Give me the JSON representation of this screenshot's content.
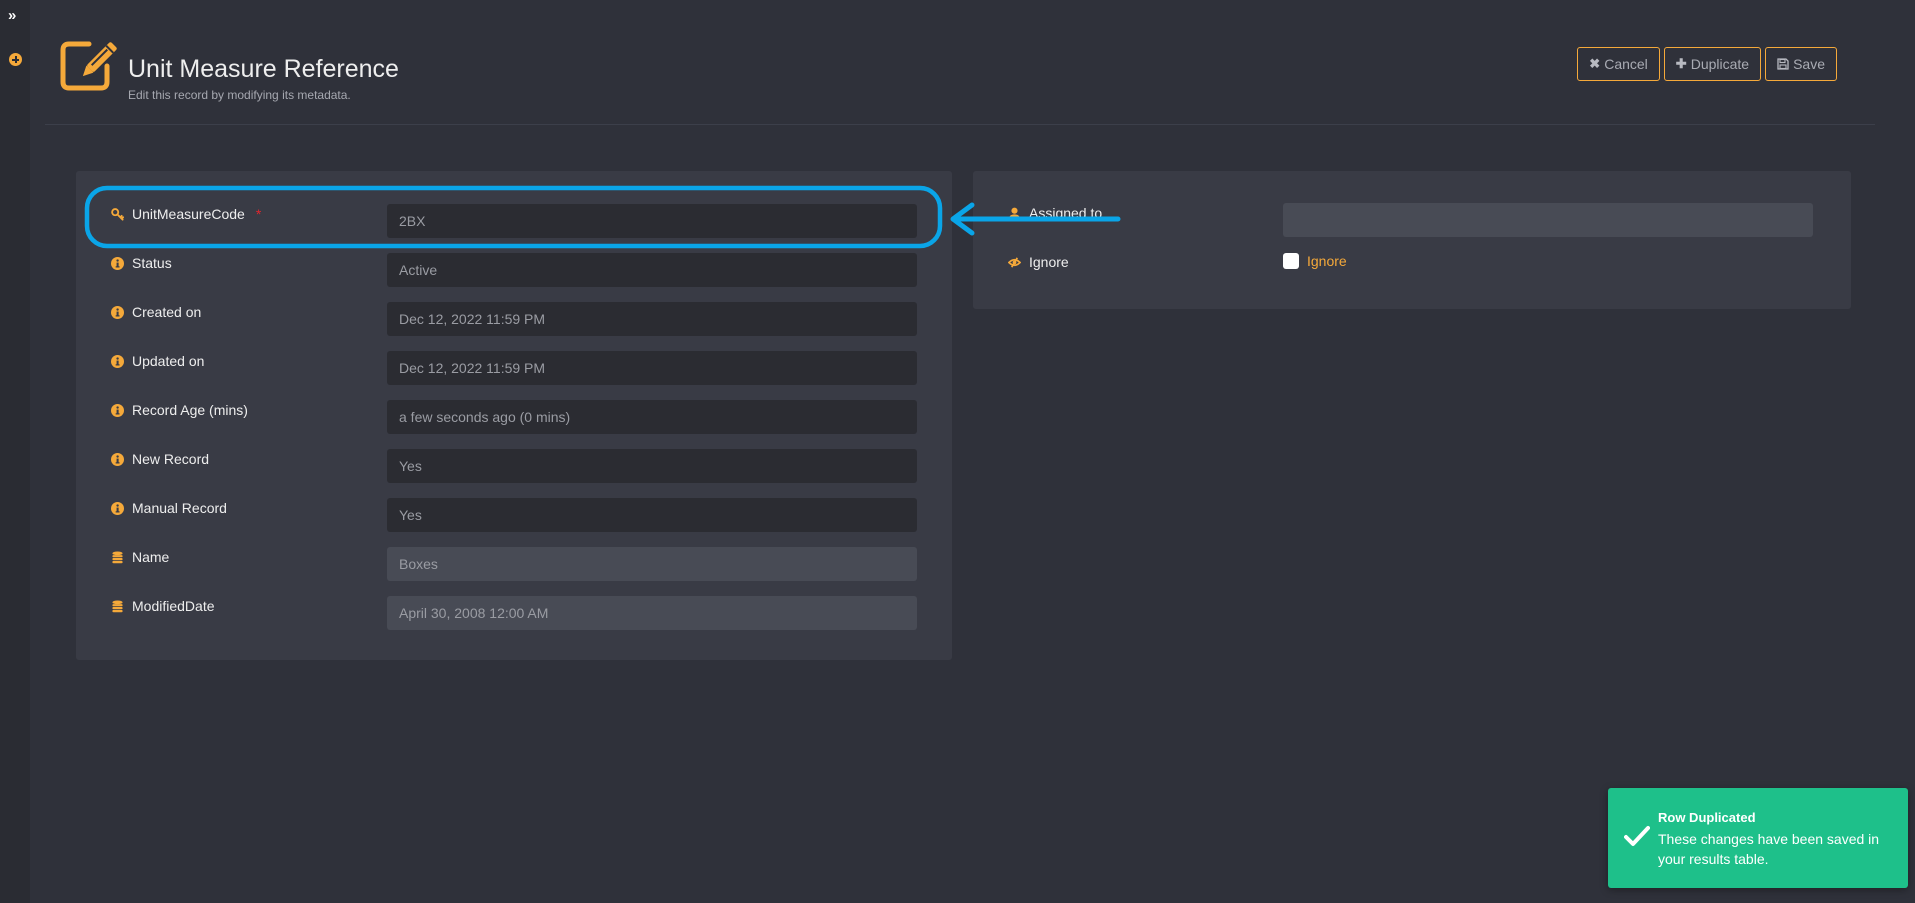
{
  "sidebar": {
    "expand_icon": "chevrons-right-icon",
    "add_icon": "plus-circle-icon"
  },
  "header": {
    "icon": "edit-pencil-icon",
    "title": "Unit Measure Reference",
    "subtitle": "Edit this record by modifying its metadata."
  },
  "toolbar": {
    "cancel_label": "Cancel",
    "cancel_icon": "close-icon",
    "duplicate_label": "Duplicate",
    "duplicate_icon": "plus-icon",
    "save_label": "Save",
    "save_icon": "floppy-disk-icon"
  },
  "form": {
    "fields": [
      {
        "label": "UnitMeasureCode",
        "icon": "key-icon",
        "required": "*",
        "value": "2BX"
      },
      {
        "label": "Status",
        "icon": "info-icon",
        "value": "Active"
      },
      {
        "label": "Created on",
        "icon": "info-icon",
        "value": "Dec 12, 2022 11:59 PM"
      },
      {
        "label": "Updated on",
        "icon": "info-icon",
        "value": "Dec 12, 2022 11:59 PM"
      },
      {
        "label": "Record Age (mins)",
        "icon": "info-icon",
        "value": "a few seconds ago (0 mins)"
      },
      {
        "label": "New Record",
        "icon": "info-icon",
        "value": "Yes"
      },
      {
        "label": "Manual Record",
        "icon": "info-icon",
        "value": "Yes"
      },
      {
        "label": "Name",
        "icon": "database-icon",
        "value": "Boxes"
      },
      {
        "label": "ModifiedDate",
        "icon": "database-icon",
        "value": "April 30, 2008 12:00 AM"
      }
    ]
  },
  "side_form": {
    "assigned_to": {
      "label": "Assigned to",
      "icon": "user-icon",
      "value": ""
    },
    "ignore": {
      "label": "Ignore",
      "icon": "eye-slash-icon",
      "checkbox_label": "Ignore",
      "checked": false
    }
  },
  "toast": {
    "icon": "checkmark-icon",
    "title": "Row Duplicated",
    "message": "These changes have been saved in your results table."
  },
  "colors": {
    "accent": "#f5a93a",
    "success": "#1ec08a",
    "annotation": "#0aa5e8",
    "required": "#e0262e"
  }
}
